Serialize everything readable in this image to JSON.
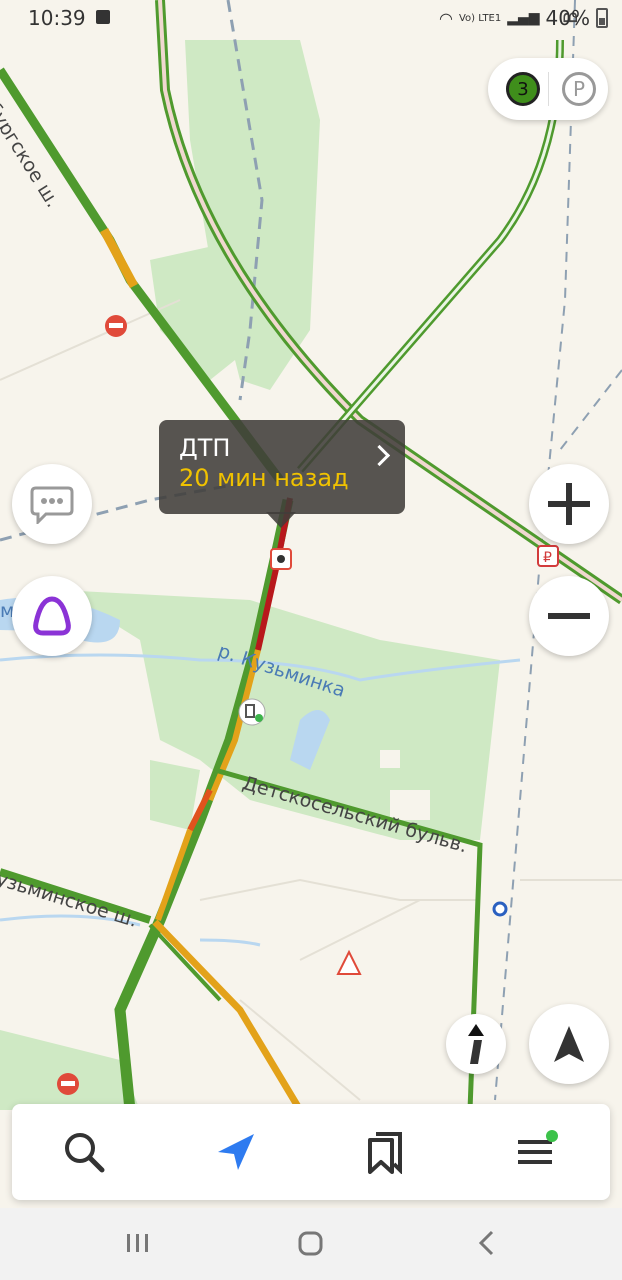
{
  "status_bar": {
    "time": "10:39",
    "battery": "40%",
    "network": "Vo) LTE1"
  },
  "top_pill": {
    "traffic_score": "3",
    "parking_label": "P"
  },
  "incident_tooltip": {
    "title": "ДТП",
    "subtitle": "20 мин назад"
  },
  "map_labels": {
    "road_peterburgskoe": "рбургское ш.",
    "river": "р. Кузьминка",
    "boulevard": "Детскосельский бульв.",
    "road_kuzminskoe": "узьминское ш.",
    "left_water": "ми",
    "top_right": "В"
  },
  "map_markers": {
    "paid_parking": "₽"
  },
  "colors": {
    "traffic_green": "#4f9a2e",
    "traffic_yellow": "#e3a21a",
    "traffic_red": "#b8181c",
    "park_green": "#cfe9c4",
    "water": "#b9d7f0",
    "alice_purple": "#8b33d6",
    "nav_blue": "#2e7bf0"
  },
  "bottom_nav": {
    "items": [
      "search-icon",
      "navigator-icon",
      "bookmarks-icon",
      "menu-icon"
    ]
  }
}
